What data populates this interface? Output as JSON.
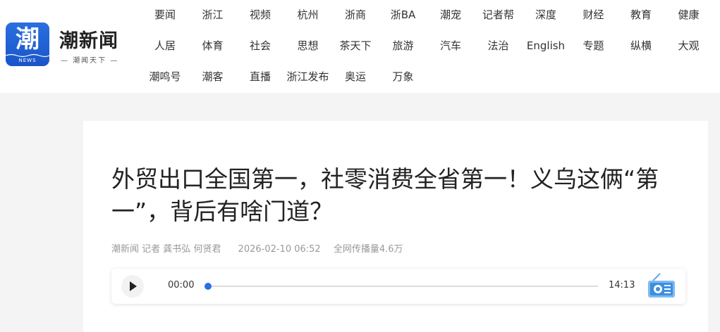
{
  "brand": {
    "name": "潮新闻",
    "slogan": "— 潮闻天下 —",
    "logo_glyph": "潮",
    "logo_news": "NEWS",
    "logo_color": "#1f5fd6"
  },
  "nav": {
    "rows": [
      [
        "要闻",
        "浙江",
        "视频",
        "杭州",
        "浙商",
        "浙BA",
        "潮宠",
        "记者帮",
        "深度",
        "财经",
        "教育",
        "健康"
      ],
      [
        "人居",
        "体育",
        "社会",
        "思想",
        "茶天下",
        "旅游",
        "汽车",
        "法治",
        "English",
        "专题",
        "纵横",
        "大观"
      ],
      [
        "潮鸣号",
        "潮客",
        "直播",
        "浙江发布",
        "奥运",
        "万象"
      ]
    ]
  },
  "article": {
    "title": "外贸出口全国第一，社零消费全省第一！义乌这俩“第一”，背后有啥门道？",
    "source_author": "潮新闻 记者 龚书弘 何贤君",
    "datetime": "2026-02-10 06:52",
    "reach": "全网传播量4.6万"
  },
  "audio": {
    "current_time": "00:00",
    "total_time": "14:13",
    "progress": 0,
    "accent_color": "#2d6ee6",
    "play_icon": "play-icon",
    "radio_icon": "radio-icon"
  }
}
